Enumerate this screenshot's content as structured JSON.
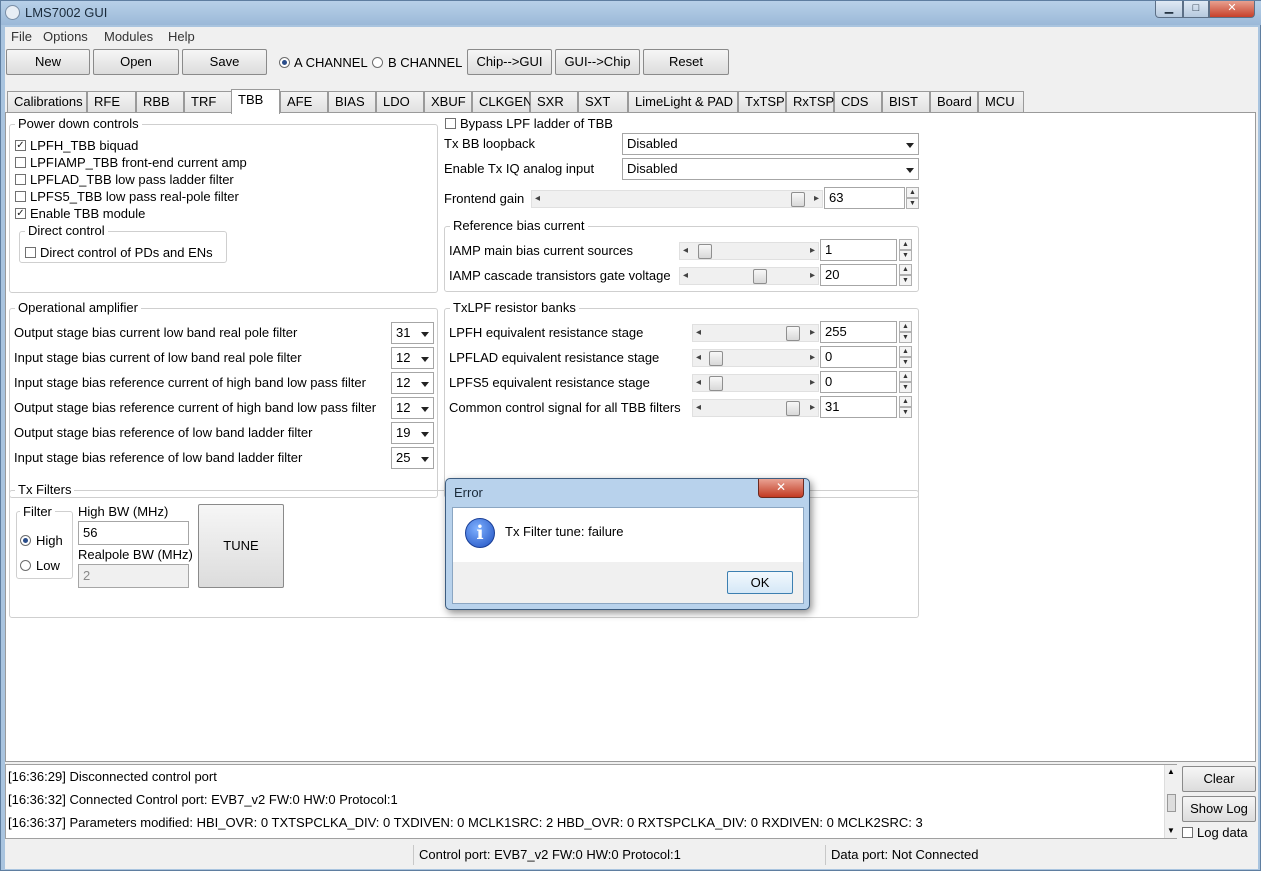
{
  "window": {
    "title": "LMS7002 GUI",
    "min_symbol": "▁",
    "max_symbol": "□",
    "close_symbol": "✕"
  },
  "menu": [
    "File",
    "Options",
    "Modules",
    "Help"
  ],
  "toolbar": {
    "new": "New",
    "open": "Open",
    "save": "Save",
    "channel_a": "A CHANNEL",
    "channel_b": "B CHANNEL",
    "chip_to_gui": "Chip-->GUI",
    "gui_to_chip": "GUI-->Chip",
    "reset": "Reset"
  },
  "tabs": [
    "Calibrations",
    "RFE",
    "RBB",
    "TRF",
    "TBB",
    "AFE",
    "BIAS",
    "LDO",
    "XBUF",
    "CLKGEN",
    "SXR",
    "SXT",
    "LimeLight & PAD",
    "TxTSP",
    "RxTSP",
    "CDS",
    "BIST",
    "Board",
    "MCU"
  ],
  "active_tab": "TBB",
  "power_down": {
    "title": "Power down controls",
    "items": [
      {
        "label": "LPFH_TBB biquad",
        "checked": true
      },
      {
        "label": "LPFIAMP_TBB front-end current amp",
        "checked": false
      },
      {
        "label": "LPFLAD_TBB low pass ladder filter",
        "checked": false
      },
      {
        "label": "LPFS5_TBB low pass real-pole filter",
        "checked": false
      },
      {
        "label": "Enable TBB module",
        "checked": true
      }
    ],
    "direct_control_title": "Direct control",
    "direct_control_label": "Direct control of PDs and ENs"
  },
  "right_top": {
    "bypass_label": "Bypass LPF ladder of TBB",
    "loopback_label": "Tx BB loopback",
    "loopback_value": "Disabled",
    "iq_label": "Enable Tx IQ analog input",
    "iq_value": "Disabled",
    "frontend_label": "Frontend gain",
    "frontend_value": "63"
  },
  "ref_bias": {
    "title": "Reference bias current",
    "rows": [
      {
        "label": "IAMP main bias current sources",
        "value": "1"
      },
      {
        "label": "IAMP cascade transistors gate voltage",
        "value": "20"
      }
    ]
  },
  "opamp": {
    "title": "Operational amplifier",
    "rows": [
      {
        "label": "Output stage bias current low band real pole filter",
        "value": "31"
      },
      {
        "label": "Input stage bias current of low band real pole filter",
        "value": "12"
      },
      {
        "label": "Input stage bias reference current of high band low pass filter",
        "value": "12"
      },
      {
        "label": "Output stage bias reference current of high band low pass filter",
        "value": "12"
      },
      {
        "label": "Output stage bias reference of low band ladder filter",
        "value": "19"
      },
      {
        "label": "Input stage bias reference of low band ladder filter",
        "value": "25"
      }
    ]
  },
  "txlpf": {
    "title": "TxLPF resistor banks",
    "rows": [
      {
        "label": "LPFH equivalent resistance stage",
        "value": "255"
      },
      {
        "label": "LPFLAD equivalent resistance stage",
        "value": "0"
      },
      {
        "label": "LPFS5 equivalent resistance stage",
        "value": "0"
      },
      {
        "label": "Common control signal for all TBB filters",
        "value": "31"
      }
    ]
  },
  "tx_filters": {
    "title": "Tx Filters",
    "filter_title": "Filter",
    "high": "High",
    "low": "Low",
    "high_bw_label": "High BW (MHz)",
    "high_bw_value": "56",
    "realpole_label": "Realpole BW (MHz)",
    "realpole_value": "2",
    "tune": "TUNE"
  },
  "dialog": {
    "title": "Error",
    "message": "Tx Filter tune: failure",
    "ok": "OK",
    "close_symbol": "✕",
    "icon_glyph": "i"
  },
  "log": {
    "lines": [
      "[16:36:29] Disconnected control port",
      "[16:36:32] Connected Control port: EVB7_v2 FW:0 HW:0 Protocol:1",
      "[16:36:37] Parameters modified: HBI_OVR: 0 TXTSPCLKA_DIV: 0 TXDIVEN: 0 MCLK1SRC: 2 HBD_OVR: 0 RXTSPCLKA_DIV: 0 RXDIVEN: 0 MCLK2SRC: 3"
    ],
    "clear": "Clear",
    "show_log": "Show Log",
    "log_data": "Log data"
  },
  "status": {
    "control_port": "Control port: EVB7_v2 FW:0 HW:0 Protocol:1",
    "data_port": "Data port: Not Connected"
  }
}
